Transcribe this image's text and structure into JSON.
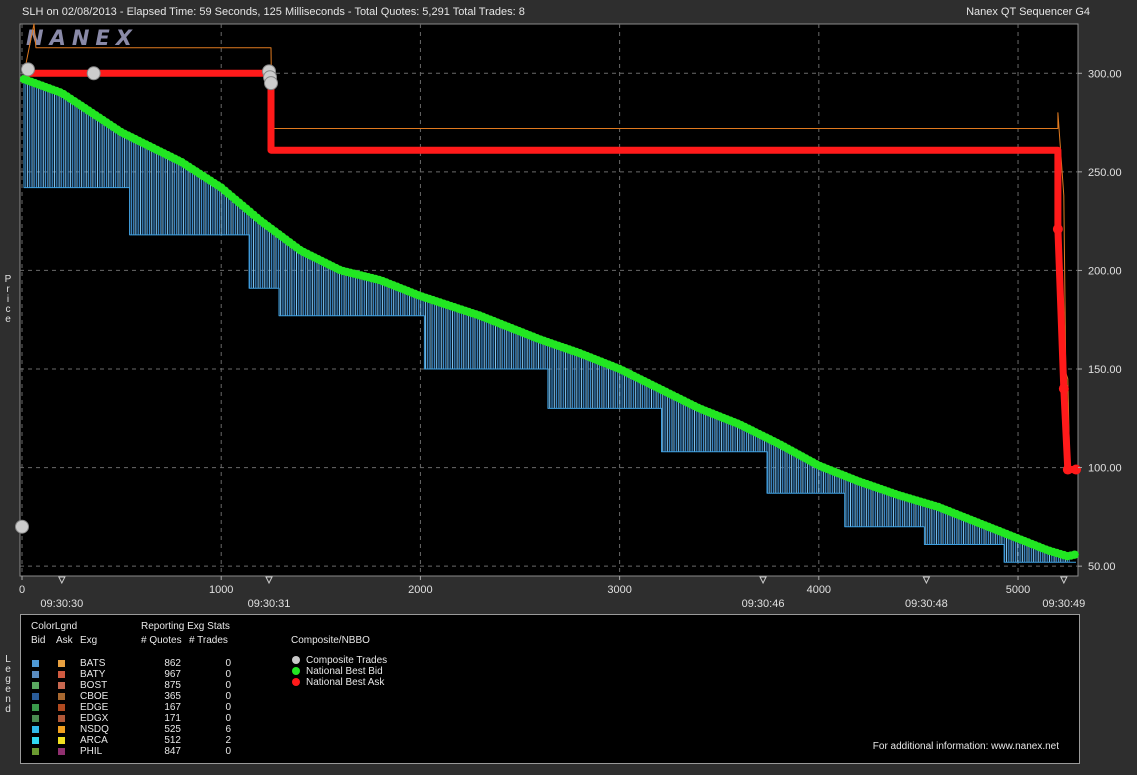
{
  "header": {
    "left": "SLH on 02/08/2013  -  Elapsed Time: 59 Seconds, 125 Milliseconds  -  Total Quotes: 5,291  Total Trades: 8",
    "right": "Nanex QT Sequencer G4"
  },
  "watermark": "NANEX",
  "y_axis_label": "Price",
  "chart_data": {
    "type": "line",
    "title": "",
    "xlabel": "",
    "ylabel": "Price",
    "xlim": [
      0,
      5291
    ],
    "ylim": [
      45,
      325
    ],
    "y_ticks": [
      "300.00",
      "250.00",
      "200.00",
      "150.00",
      "100.00",
      "50.00"
    ],
    "y_tick_values": [
      300,
      250,
      200,
      150,
      100,
      50
    ],
    "x_ticks": [
      "0",
      "1000",
      "2000",
      "3000",
      "4000",
      "5000"
    ],
    "x_tick_values": [
      0,
      1000,
      2000,
      3000,
      4000,
      5000
    ],
    "time_labels": [
      {
        "x": 200,
        "label": "09:30:30"
      },
      {
        "x": 1240,
        "label": "09:30:31"
      },
      {
        "x": 3720,
        "label": "09:30:46"
      },
      {
        "x": 4540,
        "label": "09:30:48"
      },
      {
        "x": 5230,
        "label": "09:30:49"
      }
    ],
    "grid": true,
    "series": [
      {
        "name": "National Best Bid",
        "color": "#22e622",
        "points": [
          [
            10,
            297
          ],
          [
            200,
            290
          ],
          [
            500,
            270
          ],
          [
            800,
            255
          ],
          [
            1000,
            242
          ],
          [
            1200,
            225
          ],
          [
            1400,
            210
          ],
          [
            1600,
            200
          ],
          [
            1800,
            195
          ],
          [
            2000,
            187
          ],
          [
            2300,
            177
          ],
          [
            2600,
            165
          ],
          [
            2800,
            158
          ],
          [
            3000,
            150
          ],
          [
            3200,
            140
          ],
          [
            3400,
            130
          ],
          [
            3600,
            122
          ],
          [
            3800,
            112
          ],
          [
            4000,
            101
          ],
          [
            4200,
            93
          ],
          [
            4400,
            86
          ],
          [
            4600,
            80
          ],
          [
            4800,
            72
          ],
          [
            5000,
            64
          ],
          [
            5150,
            58
          ],
          [
            5250,
            55
          ],
          [
            5291,
            56
          ]
        ]
      },
      {
        "name": "National Best Ask",
        "color": "#ff1a1a",
        "points": [
          [
            10,
            300
          ],
          [
            1250,
            300
          ],
          [
            1250,
            261
          ],
          [
            5200,
            261
          ],
          [
            5200,
            221
          ],
          [
            5230,
            140
          ],
          [
            5250,
            99
          ],
          [
            5291,
            99
          ]
        ]
      },
      {
        "name": "Composite Trades",
        "color": "#cccccc",
        "points": [
          [
            0,
            70
          ],
          [
            30,
            302
          ],
          [
            360,
            300
          ],
          [
            1240,
            301
          ],
          [
            1245,
            298
          ],
          [
            1250,
            295
          ]
        ]
      },
      {
        "name": "Bid Quotes",
        "color": "#3fa0e0",
        "points": [
          [
            10,
            297
          ],
          [
            10,
            242
          ],
          [
            540,
            242
          ],
          [
            540,
            218
          ],
          [
            1140,
            218
          ],
          [
            1140,
            191
          ],
          [
            1290,
            191
          ],
          [
            1290,
            177
          ],
          [
            2020,
            177
          ],
          [
            2020,
            150
          ],
          [
            2640,
            150
          ],
          [
            2640,
            130
          ],
          [
            3210,
            130
          ],
          [
            3210,
            108
          ],
          [
            3740,
            108
          ],
          [
            3740,
            87
          ],
          [
            4130,
            87
          ],
          [
            4130,
            70
          ],
          [
            4530,
            70
          ],
          [
            4530,
            61
          ],
          [
            4930,
            61
          ],
          [
            4930,
            52
          ],
          [
            5291,
            52
          ]
        ]
      },
      {
        "name": "Ask Quotes",
        "color": "#e07a20",
        "points": [
          [
            10,
            300
          ],
          [
            60,
            325
          ],
          [
            70,
            313
          ],
          [
            1250,
            313
          ],
          [
            1255,
            272
          ],
          [
            5200,
            272
          ],
          [
            5200,
            280
          ],
          [
            5230,
            238
          ],
          [
            5240,
            148
          ],
          [
            5250,
            145
          ],
          [
            5260,
            99
          ],
          [
            5291,
            99
          ]
        ]
      }
    ]
  },
  "legend": {
    "color_legend_title": "ColorLgnd",
    "stats_title": "Reporting Exg Stats",
    "col_bid": "Bid",
    "col_ask": "Ask",
    "col_exg": "Exg",
    "col_quotes": "# Quotes",
    "col_trades": "# Trades",
    "composite_title": "Composite/NBBO",
    "exchanges": [
      {
        "name": "BATS",
        "quotes": "862",
        "trades": "0",
        "bid_color": "#4f9ad6",
        "ask_color": "#e8a040"
      },
      {
        "name": "BATY",
        "quotes": "967",
        "trades": "0",
        "bid_color": "#5a8cc0",
        "ask_color": "#d05a40"
      },
      {
        "name": "BOST",
        "quotes": "875",
        "trades": "0",
        "bid_color": "#5aa860",
        "ask_color": "#c86850"
      },
      {
        "name": "CBOE",
        "quotes": "365",
        "trades": "0",
        "bid_color": "#2a5c9a",
        "ask_color": "#a86830"
      },
      {
        "name": "EDGE",
        "quotes": "167",
        "trades": "0",
        "bid_color": "#3a9a4a",
        "ask_color": "#b04a20"
      },
      {
        "name": "EDGX",
        "quotes": "171",
        "trades": "0",
        "bid_color": "#4a8a50",
        "ask_color": "#b05838"
      },
      {
        "name": "NSDQ",
        "quotes": "525",
        "trades": "6",
        "bid_color": "#30b8e8",
        "ask_color": "#f0a020"
      },
      {
        "name": "ARCA",
        "quotes": "512",
        "trades": "2",
        "bid_color": "#30d8f0",
        "ask_color": "#f0e020"
      },
      {
        "name": "PHIL",
        "quotes": "847",
        "trades": "0",
        "bid_color": "#6a9a30",
        "ask_color": "#903070"
      }
    ],
    "composite_items": [
      {
        "label": "Composite Trades",
        "color": "#c8c8c8"
      },
      {
        "label": "National Best Bid",
        "color": "#22e622"
      },
      {
        "label": "National Best Ask",
        "color": "#ff1a1a"
      }
    ],
    "side_label": "Legend",
    "footer": "For additional information: www.nanex.net"
  }
}
